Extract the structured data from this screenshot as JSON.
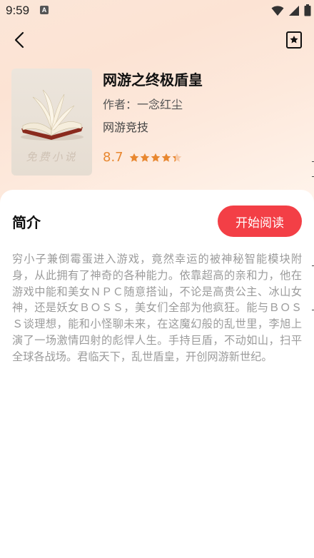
{
  "status_bar": {
    "time": "9:59",
    "notification_icon": "a-badge-icon",
    "icons": [
      "wifi-icon",
      "signal-icon",
      "battery-icon"
    ]
  },
  "nav": {
    "back_icon": "chevron-left-icon",
    "bookmark_icon": "bookmark-star-icon"
  },
  "book": {
    "title": "网游之终极盾皇",
    "author": "作者：一念红尘",
    "genre": "网游竞技",
    "rating": "8.7",
    "stars_value": 4.35,
    "stars_max": 5,
    "cover_watermark": "免费小说"
  },
  "intro": {
    "heading": "简介",
    "start_button": "开始阅读",
    "text": "穷小子兼倒霉蛋进入游戏，竟然幸运的被神秘智能模块附身，从此拥有了神奇的各种能力。依靠超高的亲和力，他在游戏中能和美女ＮＰＣ随意搭讪，不论是高贵公主、冰山女神，还是妖女ＢＯＳＳ，美女们全部为他疯狂。能与ＢＯＳＳ谈理想，能和小怪聊未来，在这魔幻般的乱世里，李旭上演了一场激情四射的彪悍人生。手持巨盾，不动如山，扫平全球各战场。君临天下，乱世盾皇，开创网游新世纪。"
  },
  "colors": {
    "accent": "#f33f46",
    "rating": "#e8872f",
    "text_secondary": "#9b9b9b"
  }
}
